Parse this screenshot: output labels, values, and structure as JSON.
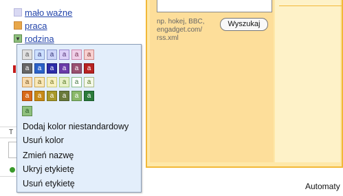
{
  "sidebar": {
    "labels": [
      {
        "name": "mało ważne",
        "color": "#d9d9f3"
      },
      {
        "name": "praca",
        "color": "#e8a74a"
      },
      {
        "name": "rodzina",
        "color": "#8fc07e",
        "caret": "▼"
      }
    ],
    "partial_letter": "T"
  },
  "color_menu": {
    "swatch_letter": "a",
    "rows": [
      [
        {
          "bg": "#e0e0e0",
          "fg": "#555555",
          "border": "#999999"
        },
        {
          "bg": "#cce0ff",
          "fg": "#333377",
          "border": "#8899cc"
        },
        {
          "bg": "#ccd4f8",
          "fg": "#333377",
          "border": "#8899cc"
        },
        {
          "bg": "#dcd0f8",
          "fg": "#553377",
          "border": "#9988cc"
        },
        {
          "bg": "#f0d0e8",
          "fg": "#773355",
          "border": "#cc88aa"
        },
        {
          "bg": "#f8d0d0",
          "fg": "#773333",
          "border": "#cc8888"
        }
      ],
      [
        {
          "bg": "#666666",
          "fg": "#ffffff",
          "border": "#444444"
        },
        {
          "bg": "#2a62c8",
          "fg": "#ffffff",
          "border": "#1a4298"
        },
        {
          "bg": "#2c2ca8",
          "fg": "#ffffff",
          "border": "#1a1a78"
        },
        {
          "bg": "#6a3aa8",
          "fg": "#ffffff",
          "border": "#4a2a78"
        },
        {
          "bg": "#985070",
          "fg": "#ffffff",
          "border": "#703050"
        },
        {
          "bg": "#b82222",
          "fg": "#ffffff",
          "border": "#881111"
        }
      ],
      [
        {
          "bg": "#f8dcb0",
          "fg": "#775522",
          "border": "#cc9955"
        },
        {
          "bg": "#fae8b8",
          "fg": "#776622",
          "border": "#ccaa55"
        },
        {
          "bg": "#f8f0c0",
          "fg": "#777722",
          "border": "#cccc77"
        },
        {
          "bg": "#e8f0c8",
          "fg": "#557722",
          "border": "#aacc77"
        },
        {
          "bg": "#ffffff",
          "fg": "#447744",
          "border": "#88bb88"
        },
        {
          "bg": "#f4f8e8",
          "fg": "#557722",
          "border": "#aabb88"
        }
      ],
      [
        {
          "bg": "#d86a1a",
          "fg": "#ffffff",
          "border": "#a84a0a"
        },
        {
          "bg": "#c88a18",
          "fg": "#ffffff",
          "border": "#986a08"
        },
        {
          "bg": "#a8982a",
          "fg": "#ffffff",
          "border": "#787018"
        },
        {
          "bg": "#6a7a3a",
          "fg": "#ffffff",
          "border": "#4a5a2a"
        },
        {
          "bg": "#8ab86a",
          "fg": "#ffffff",
          "border": "#5a8a4a"
        },
        {
          "bg": "#2a7a3a",
          "fg": "#ffffff",
          "border": "#1a5a2a"
        }
      ]
    ],
    "selected": {
      "bg": "#8fc07e",
      "fg": "#2a5a2a",
      "border": "#5a8a4a"
    },
    "items": [
      "Dodaj kolor niestandardowy",
      "Usuń kolor",
      "Zmień nazwę",
      "Ukryj etykietę",
      "Usuń etykietę"
    ]
  },
  "feed_panel": {
    "hint": "np. hokej, BBC, engadget.com/ rss.xml",
    "search_button": "Wyszukaj"
  },
  "footer": {
    "text": "Automaty"
  }
}
